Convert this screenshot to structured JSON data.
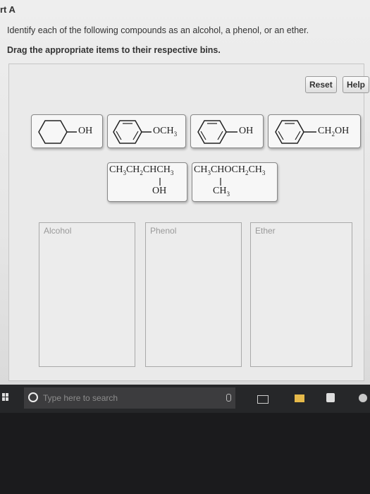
{
  "header": {
    "part_title": "rt A",
    "instruction": "Identify each of the following compounds as an alcohol, a phenol, or an ether.",
    "drag_instruction": "Drag the appropriate items to their respective bins."
  },
  "toolbar": {
    "reset_label": "Reset",
    "help_label": "Help"
  },
  "items": {
    "cyclohexanol": {
      "group_text": "OH"
    },
    "anisole": {
      "group_main": "OCH",
      "group_sub": "3"
    },
    "phenol": {
      "group_text": "OH"
    },
    "benzyl_alcohol": {
      "g1": "CH",
      "g2": "2",
      "g3": "OH"
    },
    "butan_2_ol": {
      "p1": "CH",
      "p2": "3",
      "p3": "CH",
      "p4": "2",
      "p5": "CHCH",
      "p6": "3",
      "sub_main": "OH"
    },
    "ether_branched": {
      "p1": "CH",
      "p2": "3",
      "p3": "CHOCH",
      "p4": "2",
      "p5": "CH",
      "p6": "3",
      "sub_main": "CH",
      "sub_sub": "3"
    }
  },
  "bins": [
    {
      "label": "Alcohol"
    },
    {
      "label": "Phenol"
    },
    {
      "label": "Ether"
    }
  ],
  "taskbar": {
    "search_placeholder": "Type here to search"
  }
}
